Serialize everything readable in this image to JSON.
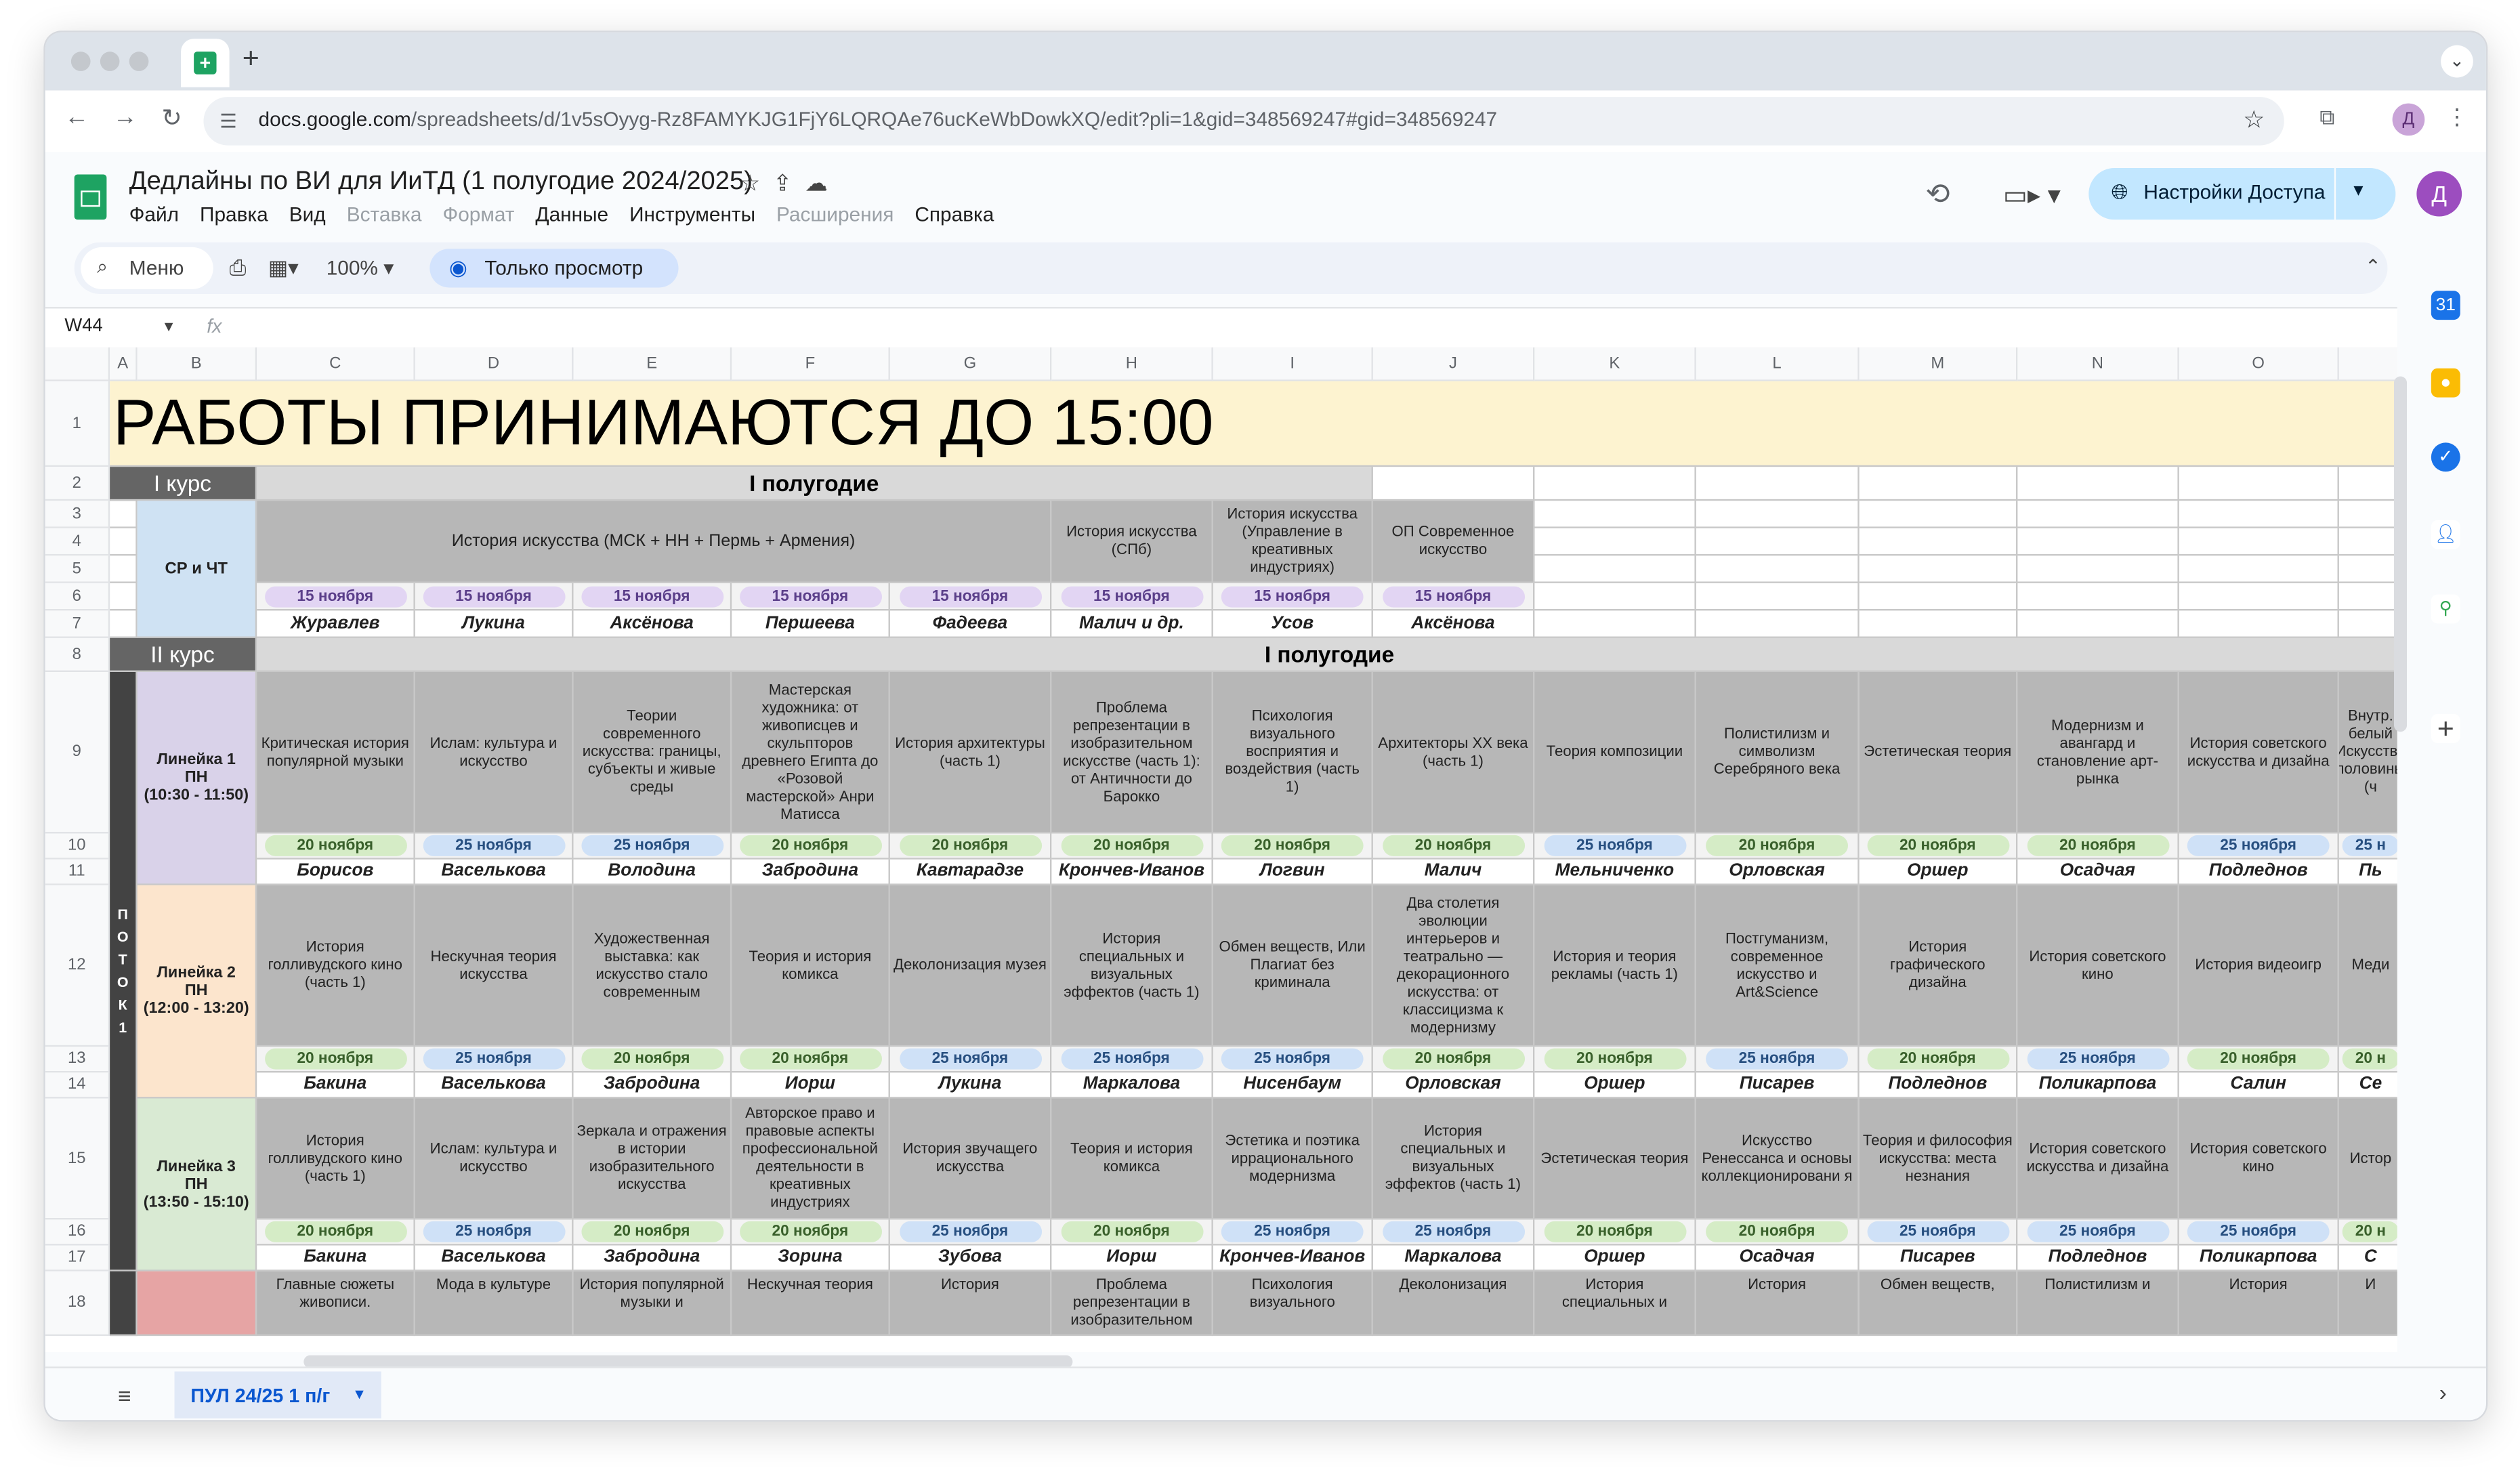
{
  "browser": {
    "url_host": "docs.google.com",
    "url_path": "/spreadsheets/d/1v5sOyyg-Rz8FAMYKJG1FjY6LQRQAe76ucKeWbDowkXQ/edit?pli=1&gid=348569247#gid=348569247",
    "new_tab": "+",
    "profile_initial": "Д"
  },
  "doc": {
    "title": "Дедлайны по ВИ для ИиТД (1 полугодие 2024/2025)",
    "menu": [
      {
        "label": "Файл",
        "enabled": true
      },
      {
        "label": "Правка",
        "enabled": true
      },
      {
        "label": "Вид",
        "enabled": true
      },
      {
        "label": "Вставка",
        "enabled": false
      },
      {
        "label": "Формат",
        "enabled": false
      },
      {
        "label": "Данные",
        "enabled": true
      },
      {
        "label": "Инструменты",
        "enabled": true
      },
      {
        "label": "Расширения",
        "enabled": false
      },
      {
        "label": "Справка",
        "enabled": true
      }
    ],
    "share_label": "Настройки Доступа",
    "avatar_initial": "Д"
  },
  "toolbar": {
    "menu_search": "Меню",
    "zoom": "100%",
    "view_only": "Только просмотр"
  },
  "formula_bar": {
    "cell_ref": "W44",
    "fx": "fx"
  },
  "grid": {
    "columns": [
      "A",
      "B",
      "C",
      "D",
      "E",
      "F",
      "G",
      "H",
      "I",
      "J",
      "K",
      "L",
      "M",
      "N",
      "O"
    ],
    "rows": [
      "1",
      "2",
      "3",
      "4",
      "5",
      "6",
      "7",
      "8",
      "9",
      "10",
      "11",
      "12",
      "13",
      "14",
      "15",
      "16",
      "17",
      "18"
    ],
    "banner": "РАБОТЫ ПРИНИМАЮТСЯ ДО 15:00",
    "course1": "I курс",
    "course1_term": "I полугодие",
    "course2": "II курс",
    "course2_term": "I полугодие",
    "stream_label": "ПОТОК 1",
    "stream2_label": "ПОТОК",
    "group_cp": "СР и ЧТ",
    "c1_subjects": [
      "История искусства (МСК + НН + Пермь + Армения)",
      "История искусства (СПб)",
      "История искусства (Управление в креативных индустриях)",
      "ОП Современное искусство"
    ],
    "c1_dates": [
      "15 ноября",
      "15 ноября",
      "15 ноября",
      "15 ноября",
      "15 ноября",
      "15 ноября",
      "15 ноября",
      "15 ноября"
    ],
    "c1_names": [
      "Журавлев",
      "Лукина",
      "Аксёнова",
      "Першеева",
      "Фадеева",
      "Малич и др.",
      "Усов",
      "Аксёнова"
    ],
    "line1": {
      "label": "Линейка 1\nПН\n(10:30 - 11:50)",
      "subjects": [
        "Критическая история популярной музыки",
        "Ислам: культура и искусство",
        "Теории современного искусства: границы, субъекты и живые среды",
        "Мастерская художника: от живописцев и скульпторов древнего Египта до «Розовой мастерской» Анри Матисса",
        "История архитектуры (часть 1)",
        "Проблема репрезентации в изобразительном искусстве (часть 1): от Античности до Барокко",
        "Психология визуального восприятия и воздействия (часть 1)",
        "Архитекторы XX века (часть 1)",
        "Теория композиции",
        "Полистилизм и символизм Серебряного века",
        "Эстетическая теория",
        "Модернизм и авангард и становление арт-рынка",
        "История советского искусства и дизайна",
        "Внутр. белый Искусство половины (ч"
      ],
      "dates": [
        "20 ноября",
        "25 ноября",
        "25 ноября",
        "20 ноября",
        "20 ноября",
        "20 ноября",
        "20 ноября",
        "20 ноября",
        "25 ноября",
        "20 ноября",
        "20 ноября",
        "20 ноября",
        "25 ноября",
        "25 н"
      ],
      "names": [
        "Борисов",
        "Васелькова",
        "Володина",
        "Забродина",
        "Кавтарадзе",
        "Крончев-Иванов",
        "Логвин",
        "Малич",
        "Мельниченко",
        "Орловская",
        "Оршер",
        "Осадчая",
        "Подледнов",
        "Пь"
      ]
    },
    "line2": {
      "label": "Линейка 2\nПН\n(12:00 - 13:20)",
      "subjects": [
        "История голливудского кино (часть 1)",
        "Нескучная теория искусства",
        "Художественная выставка: как искусство стало современным",
        "Теория и история комикса",
        "Деколонизация музея",
        "История специальных и визуальных эффектов (часть 1)",
        "Обмен веществ, Или Плагиат без криминала",
        "Два столетия эволюции интерьеров и театрально — декорационного искусства: от классицизма к модернизму",
        "История и теория рекламы (часть 1)",
        "Постгуманизм, современное искусство и Art&Science",
        "История графического дизайна",
        "История советского кино",
        "История видеоигр",
        "Меди"
      ],
      "dates": [
        "20 ноября",
        "25 ноября",
        "20 ноября",
        "20 ноября",
        "25 ноября",
        "25 ноября",
        "25 ноября",
        "20 ноября",
        "20 ноября",
        "25 ноября",
        "20 ноября",
        "25 ноября",
        "20 ноября",
        "20 н"
      ],
      "names": [
        "Бакина",
        "Васелькова",
        "Забродина",
        "Иорш",
        "Лукина",
        "Маркалова",
        "Нисенбаум",
        "Орловская",
        "Оршер",
        "Писарев",
        "Подледнов",
        "Поликарпова",
        "Салин",
        "Се"
      ]
    },
    "line3": {
      "label": "Линейка 3\nПН\n(13:50 - 15:10)",
      "subjects": [
        "История голливудского кино (часть 1)",
        "Ислам: культура и искусство",
        "Зеркала и отражения в истории изобразительного искусства",
        "Авторское право и правовые аспекты профессиональной деятельности в креативных индустриях",
        "История звучащего искусства",
        "Теория и история комикса",
        "Эстетика и поэтика иррационального модернизма",
        "История специальных и визуальных эффектов (часть 1)",
        "Эстетическая теория",
        "Искусство Ренессанса и основы коллекционировани я",
        "Теория и философия искусства: места незнания",
        "История советского искусства и дизайна",
        "История советского кино",
        "Истор"
      ],
      "dates": [
        "20 ноября",
        "25 ноября",
        "20 ноября",
        "20 ноября",
        "25 ноября",
        "20 ноября",
        "25 ноября",
        "25 ноября",
        "20 ноября",
        "20 ноября",
        "25 ноября",
        "25 ноября",
        "25 ноября",
        "20 н"
      ],
      "names": [
        "Бакина",
        "Васелькова",
        "Забродина",
        "Зорина",
        "Зубова",
        "Иорш",
        "Крончев-Иванов",
        "Маркалова",
        "Оршер",
        "Осадчая",
        "Писарев",
        "Подледнов",
        "Поликарпова",
        "С"
      ]
    },
    "line4_partial": [
      "Главные сюжеты живописи.",
      "Мода в культуре",
      "История популярной музыки и",
      "Нескучная теория",
      "История",
      "Проблема репрезентации в изобразительном",
      "Психология визуального",
      "Деколонизация",
      "История специальных и",
      "История",
      "Обмен веществ,",
      "Полистилизм и",
      "История",
      "И"
    ]
  },
  "sheet_tab": "ПУЛ 24/25 1 п/г",
  "colors": {
    "banner_bg": "#fdf3d0",
    "course_bg": "#656565",
    "term_bg": "#d9d9d9",
    "subject_bg": "#b7b7b7",
    "cp_bg": "#cfe2f3",
    "line1_bg": "#d9d2e9",
    "line2_bg": "#fce5cd",
    "line3_bg": "#d9ead3",
    "line4_bg": "#e6a4a4",
    "stream_bg": "#434343"
  }
}
